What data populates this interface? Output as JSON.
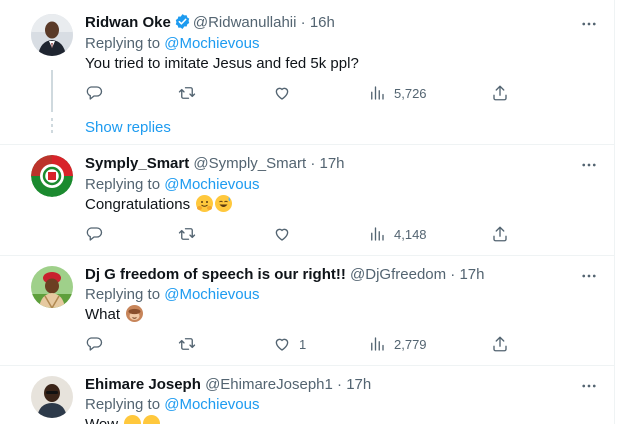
{
  "tweets": [
    {
      "name": "Ridwan Oke",
      "handle": "@Ridwanullahii",
      "time": "16h",
      "verified": true,
      "replying_prefix": "Replying to",
      "replying_to": "@Mochievous",
      "text": "You tried to imitate Jesus and fed 5k ppl?",
      "like_count": "",
      "views": "5,726"
    },
    {
      "name": "Symply_Smart",
      "handle": "@Symply_Smart",
      "time": "17h",
      "verified": false,
      "replying_prefix": "Replying to",
      "replying_to": "@Mochievous",
      "text": "Congratulations",
      "emojis": [
        "hugging-face",
        "grinning-sweat"
      ],
      "like_count": "",
      "views": "4,148"
    },
    {
      "name": "Dj G freedom of speech is our right!!",
      "handle": "@DjGfreedom",
      "time": "17h",
      "verified": false,
      "replying_prefix": "Replying to",
      "replying_to": "@Mochievous",
      "text": "What",
      "emojis": [
        "see-no-evil-monkey"
      ],
      "like_count": "1",
      "views": "2,779"
    },
    {
      "name": "Ehimare Joseph",
      "handle": "@EhimareJoseph1",
      "time": "17h",
      "verified": false,
      "replying_prefix": "Replying to",
      "replying_to": "@Mochievous",
      "text": "Wow",
      "emojis": [
        "flushed",
        "flushed"
      ]
    }
  ],
  "thread": {
    "show_replies": "Show replies"
  },
  "separator": "·",
  "colors": {
    "link": "#1d9bf0",
    "muted": "#536471",
    "text": "#0f1419",
    "border": "#eff3f4"
  }
}
